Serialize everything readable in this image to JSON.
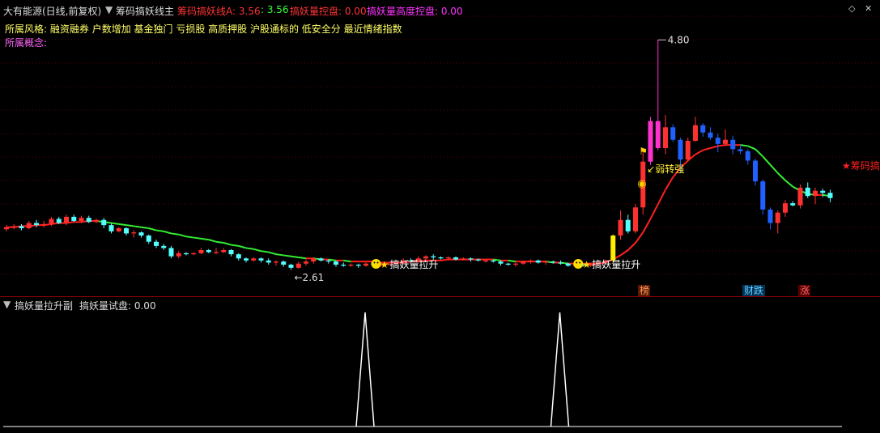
{
  "header": {
    "title": "大有能源(日线,前复权)",
    "indicator_name": "筹码搞妖线主",
    "items": [
      {
        "label": "筹码搞妖线A: 3.56",
        "color": "#ff3333"
      },
      {
        "label": ": 3.56",
        "color": "#33ff33"
      },
      {
        "label": "搞妖量控盘: 0.00",
        "color": "#ff3333"
      },
      {
        "label": "搞妖量高度控盘: 0.00",
        "color": "#ff33ff"
      }
    ],
    "style_label": "所属风格:",
    "style_value": "融资融券 户数增加 基金独门 亏损股 高质押股 沪股通标的 低安全分 最近情绪指数",
    "concept_label": "所属概念:"
  },
  "sub_header": {
    "name": "搞妖量拉升副",
    "item": "搞妖量试盘: 0.00"
  },
  "annotations": {
    "high_label": "4.80",
    "low_label": "2.61",
    "signal1": "搞妖量拉升",
    "signal2": "搞妖量拉升",
    "weak_to_strong": "弱转强",
    "chip": "★筹码搞",
    "tags": [
      {
        "text": "榜",
        "color": "#ff9966",
        "bg": "#5a1a00"
      },
      {
        "text": "财跌",
        "color": "#66ccff",
        "bg": "#003355"
      },
      {
        "text": "涨",
        "color": "#ff6666",
        "bg": "#550000"
      }
    ]
  },
  "icons": [
    "chevron-down-icon",
    "diamond-icon",
    "close-icon",
    "smiley-icon",
    "star-icon",
    "money-bag-icon",
    "pennant-icon"
  ],
  "chart_data": {
    "type": "candlestick",
    "candles": [
      [
        2.98,
        3.0,
        3.02,
        2.96
      ],
      [
        3.0,
        3.01,
        3.03,
        2.98
      ],
      [
        3.01,
        2.99,
        3.03,
        2.97
      ],
      [
        2.99,
        3.04,
        3.06,
        2.98
      ],
      [
        3.04,
        3.02,
        3.07,
        3.0
      ],
      [
        3.02,
        3.03,
        3.06,
        3.0
      ],
      [
        3.03,
        3.08,
        3.1,
        3.01
      ],
      [
        3.08,
        3.04,
        3.1,
        3.03
      ],
      [
        3.04,
        3.1,
        3.12,
        3.02
      ],
      [
        3.1,
        3.06,
        3.12,
        3.05
      ],
      [
        3.06,
        3.09,
        3.11,
        3.04
      ],
      [
        3.09,
        3.05,
        3.11,
        3.04
      ],
      [
        3.05,
        3.07,
        3.08,
        3.04
      ],
      [
        3.07,
        3.02,
        3.09,
        2.99
      ],
      [
        3.02,
        2.96,
        3.04,
        2.94
      ],
      [
        2.96,
        2.99,
        3.0,
        2.95
      ],
      [
        2.99,
        2.94,
        3.0,
        2.92
      ],
      [
        2.94,
        2.95,
        2.97,
        2.9
      ],
      [
        2.95,
        2.92,
        2.96,
        2.9
      ],
      [
        2.92,
        2.86,
        2.93,
        2.84
      ],
      [
        2.86,
        2.82,
        2.88,
        2.8
      ],
      [
        2.82,
        2.8,
        2.84,
        2.78
      ],
      [
        2.8,
        2.72,
        2.82,
        2.7
      ],
      [
        2.72,
        2.75,
        2.77,
        2.7
      ],
      [
        2.75,
        2.74,
        2.76,
        2.73
      ],
      [
        2.74,
        2.75,
        2.76,
        2.73
      ],
      [
        2.75,
        2.78,
        2.8,
        2.74
      ],
      [
        2.78,
        2.76,
        2.79,
        2.75
      ],
      [
        2.76,
        2.76,
        2.8,
        2.74
      ],
      [
        2.76,
        2.78,
        2.8,
        2.75
      ],
      [
        2.78,
        2.74,
        2.79,
        2.72
      ],
      [
        2.74,
        2.7,
        2.75,
        2.68
      ],
      [
        2.7,
        2.68,
        2.71,
        2.66
      ],
      [
        2.68,
        2.7,
        2.71,
        2.67
      ],
      [
        2.7,
        2.68,
        2.71,
        2.66
      ],
      [
        2.68,
        2.66,
        2.7,
        2.64
      ],
      [
        2.66,
        2.67,
        2.68,
        2.63
      ],
      [
        2.67,
        2.64,
        2.68,
        2.62
      ],
      [
        2.64,
        2.61,
        2.65,
        2.59
      ],
      [
        2.61,
        2.65,
        2.67,
        2.6
      ],
      [
        2.65,
        2.67,
        2.69,
        2.63
      ],
      [
        2.67,
        2.7,
        2.71,
        2.65
      ],
      [
        2.7,
        2.68,
        2.71,
        2.67
      ],
      [
        2.68,
        2.67,
        2.69,
        2.65
      ],
      [
        2.67,
        2.64,
        2.68,
        2.62
      ],
      [
        2.64,
        2.63,
        2.66,
        2.62
      ],
      [
        2.63,
        2.64,
        2.65,
        2.62
      ],
      [
        2.64,
        2.63,
        2.65,
        2.61
      ],
      [
        2.63,
        2.65,
        2.66,
        2.62
      ],
      [
        2.65,
        2.64,
        2.66,
        2.63
      ],
      [
        2.64,
        2.64,
        2.66,
        2.62
      ],
      [
        2.64,
        2.65,
        2.66,
        2.63
      ],
      [
        2.65,
        2.66,
        2.67,
        2.64
      ],
      [
        2.66,
        2.68,
        2.7,
        2.65
      ],
      [
        2.68,
        2.67,
        2.7,
        2.66
      ],
      [
        2.67,
        2.7,
        2.72,
        2.66
      ],
      [
        2.7,
        2.72,
        2.73,
        2.68
      ],
      [
        2.72,
        2.71,
        2.74,
        2.69
      ],
      [
        2.71,
        2.7,
        2.72,
        2.69
      ],
      [
        2.7,
        2.71,
        2.72,
        2.68
      ],
      [
        2.71,
        2.69,
        2.72,
        2.68
      ],
      [
        2.69,
        2.7,
        2.71,
        2.68
      ],
      [
        2.7,
        2.69,
        2.71,
        2.67
      ],
      [
        2.69,
        2.68,
        2.7,
        2.67
      ],
      [
        2.68,
        2.68,
        2.69,
        2.66
      ],
      [
        2.68,
        2.67,
        2.69,
        2.66
      ],
      [
        2.67,
        2.65,
        2.68,
        2.63
      ],
      [
        2.65,
        2.64,
        2.66,
        2.63
      ],
      [
        2.64,
        2.65,
        2.66,
        2.62
      ],
      [
        2.65,
        2.67,
        2.68,
        2.64
      ],
      [
        2.67,
        2.68,
        2.69,
        2.65
      ],
      [
        2.68,
        2.66,
        2.69,
        2.65
      ],
      [
        2.66,
        2.67,
        2.68,
        2.64
      ],
      [
        2.67,
        2.66,
        2.68,
        2.65
      ],
      [
        2.66,
        2.65,
        2.68,
        2.64
      ],
      [
        2.65,
        2.63,
        2.66,
        2.62
      ],
      [
        2.63,
        2.64,
        2.65,
        2.62
      ],
      [
        2.64,
        2.63,
        2.65,
        2.62
      ],
      [
        2.63,
        2.65,
        2.66,
        2.62
      ],
      [
        2.65,
        2.66,
        2.67,
        2.63
      ],
      [
        2.66,
        2.68,
        2.69,
        2.65
      ],
      [
        2.68,
        2.92,
        2.93,
        2.66
      ],
      [
        2.92,
        3.07,
        3.16,
        2.88
      ],
      [
        3.07,
        2.96,
        3.12,
        2.94
      ],
      [
        2.96,
        3.19,
        3.22,
        2.94
      ],
      [
        3.19,
        3.63,
        3.72,
        3.12
      ],
      [
        3.63,
        4.02,
        4.06,
        3.6
      ],
      [
        4.02,
        3.76,
        4.8,
        3.74
      ],
      [
        3.76,
        3.96,
        4.08,
        3.7
      ],
      [
        3.96,
        3.84,
        3.99,
        3.82
      ],
      [
        3.84,
        3.65,
        3.86,
        3.52
      ],
      [
        3.65,
        3.83,
        3.86,
        3.63
      ],
      [
        3.83,
        3.98,
        4.06,
        3.82
      ],
      [
        3.98,
        3.91,
        4.0,
        3.87
      ],
      [
        3.91,
        3.86,
        3.96,
        3.84
      ],
      [
        3.86,
        3.8,
        3.9,
        3.72
      ],
      [
        3.8,
        3.84,
        3.94,
        3.78
      ],
      [
        3.84,
        3.75,
        3.88,
        3.7
      ],
      [
        3.75,
        3.73,
        3.79,
        3.7
      ],
      [
        3.73,
        3.64,
        3.75,
        3.6
      ],
      [
        3.64,
        3.44,
        3.66,
        3.4
      ],
      [
        3.44,
        3.17,
        3.46,
        3.12
      ],
      [
        3.17,
        3.04,
        3.19,
        2.98
      ],
      [
        3.04,
        3.14,
        3.16,
        2.94
      ],
      [
        3.14,
        3.23,
        3.26,
        3.1
      ],
      [
        3.23,
        3.21,
        3.25,
        3.2
      ],
      [
        3.21,
        3.38,
        3.41,
        3.18
      ],
      [
        3.38,
        3.3,
        3.43,
        3.28
      ],
      [
        3.3,
        3.35,
        3.38,
        3.22
      ],
      [
        3.35,
        3.33,
        3.37,
        3.29
      ],
      [
        3.33,
        3.28,
        3.36,
        3.24
      ]
    ],
    "ma": [
      3.0,
      3.0,
      3.01,
      3.01,
      3.02,
      3.02,
      3.03,
      3.04,
      3.04,
      3.05,
      3.05,
      3.06,
      3.06,
      3.05,
      3.04,
      3.03,
      3.02,
      3.01,
      3.0,
      2.99,
      2.97,
      2.96,
      2.94,
      2.93,
      2.91,
      2.9,
      2.89,
      2.88,
      2.86,
      2.85,
      2.83,
      2.82,
      2.8,
      2.79,
      2.77,
      2.76,
      2.74,
      2.73,
      2.72,
      2.71,
      2.7,
      2.7,
      2.69,
      2.69,
      2.68,
      2.68,
      2.67,
      2.67,
      2.67,
      2.67,
      2.66,
      2.66,
      2.66,
      2.66,
      2.67,
      2.67,
      2.68,
      2.68,
      2.68,
      2.69,
      2.69,
      2.69,
      2.69,
      2.69,
      2.69,
      2.69,
      2.68,
      2.68,
      2.67,
      2.67,
      2.67,
      2.67,
      2.67,
      2.66,
      2.66,
      2.65,
      2.65,
      2.65,
      2.65,
      2.65,
      2.66,
      2.69,
      2.73,
      2.78,
      2.85,
      2.95,
      3.08,
      3.22,
      3.36,
      3.48,
      3.57,
      3.64,
      3.7,
      3.74,
      3.76,
      3.78,
      3.79,
      3.79,
      3.79,
      3.78,
      3.75,
      3.68,
      3.6,
      3.52,
      3.45,
      3.39,
      3.35,
      3.32,
      3.31,
      3.31,
      3.3
    ],
    "indicator": {
      "x": [
        48,
        74
      ],
      "value": 1.0
    },
    "ylim": [
      2.5,
      4.95
    ]
  }
}
